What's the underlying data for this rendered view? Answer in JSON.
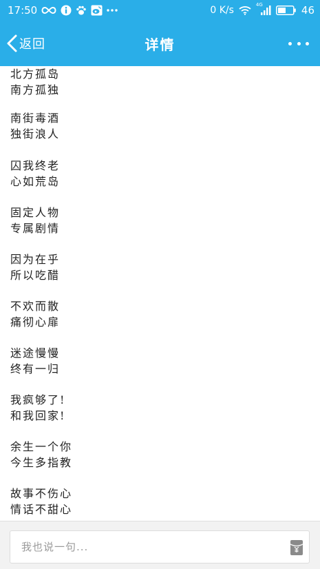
{
  "status_bar": {
    "time": "17:50",
    "network_speed": "0 K/s",
    "network_type": "4G",
    "battery": "46"
  },
  "app_bar": {
    "back_label": "返回",
    "title": "详情"
  },
  "poem": {
    "stanzas": [
      {
        "line1": "北方孤岛",
        "line2": "南方孤独"
      },
      {
        "line1": "南街毒酒",
        "line2": "独街浪人"
      },
      {
        "line1": "囚我终老",
        "line2": "心如荒岛"
      },
      {
        "line1": "固定人物",
        "line2": "专属剧情"
      },
      {
        "line1": "因为在乎",
        "line2": "所以吃醋"
      },
      {
        "line1": "不欢而散",
        "line2": "痛彻心扉"
      },
      {
        "line1": "迷途慢慢",
        "line2": "终有一归"
      },
      {
        "line1": "我疯够了!",
        "line2": "和我回家!"
      },
      {
        "line1": "余生一个你",
        "line2": "今生多指教"
      },
      {
        "line1": "故事不伤心",
        "line2": "情话不甜心"
      }
    ]
  },
  "comment_bar": {
    "placeholder": "我也说一句..."
  },
  "colors": {
    "brand_blue": "#2aaee8",
    "text": "#222222",
    "placeholder": "#9a9a9a"
  },
  "icons": {
    "status_left": [
      "infinity-icon",
      "info-icon",
      "paw-icon",
      "weibo-icon",
      "more-dots-icon"
    ],
    "status_right": [
      "wifi-icon",
      "signal-icon",
      "battery-icon"
    ],
    "app_bar": [
      "back-chevron-icon",
      "overflow-menu-icon"
    ],
    "comment_bar": [
      "red-packet-icon"
    ]
  }
}
